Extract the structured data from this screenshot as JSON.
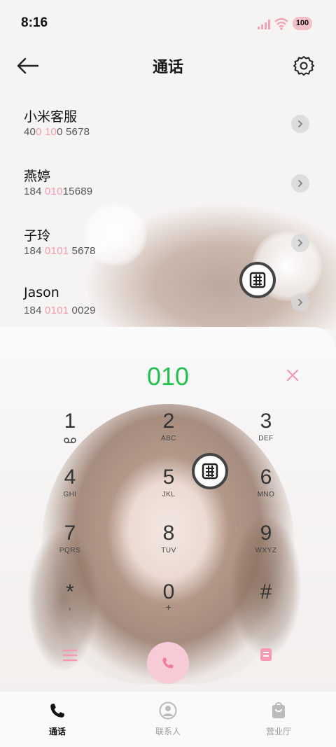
{
  "status": {
    "time": "8:16",
    "battery": "100",
    "battery_color": "#f4c0c8",
    "signal_color": "#f2a3b3"
  },
  "header": {
    "title": "通话",
    "back_icon": "arrow-left-icon",
    "settings_icon": "gear-icon"
  },
  "contacts": [
    {
      "name": "小米客服",
      "number_parts": [
        "40",
        "0",
        " ",
        "10",
        "0 5678"
      ]
    },
    {
      "name": "燕婷",
      "number_parts": [
        "184 ",
        "010",
        "",
        "",
        "15689"
      ]
    },
    {
      "name": "子玲",
      "number_parts": [
        "184 ",
        "0101",
        "",
        "",
        " 5678"
      ]
    },
    {
      "name": "Jason",
      "number_parts": [
        "184 ",
        "0101",
        "",
        "",
        " 0029"
      ]
    }
  ],
  "dialer": {
    "input": "010",
    "input_color": "#22c04c",
    "keys": [
      {
        "digit": "1",
        "letters": ""
      },
      {
        "digit": "2",
        "letters": "ABC"
      },
      {
        "digit": "3",
        "letters": "DEF"
      },
      {
        "digit": "4",
        "letters": "GHI"
      },
      {
        "digit": "5",
        "letters": "JKL"
      },
      {
        "digit": "6",
        "letters": "MNO"
      },
      {
        "digit": "7",
        "letters": "PQRS"
      },
      {
        "digit": "8",
        "letters": "TUV"
      },
      {
        "digit": "9",
        "letters": "WXYZ"
      },
      {
        "digit": "*",
        "letters": ","
      },
      {
        "digit": "0",
        "letters": "+"
      },
      {
        "digit": "#",
        "letters": ""
      }
    ],
    "accent_color": "#f59ab0"
  },
  "bottom_nav": [
    {
      "label": "通话",
      "icon": "phone-icon",
      "active": true
    },
    {
      "label": "联系人",
      "icon": "person-icon",
      "active": false
    },
    {
      "label": "营业厅",
      "icon": "shopping-bag-icon",
      "active": false
    }
  ]
}
